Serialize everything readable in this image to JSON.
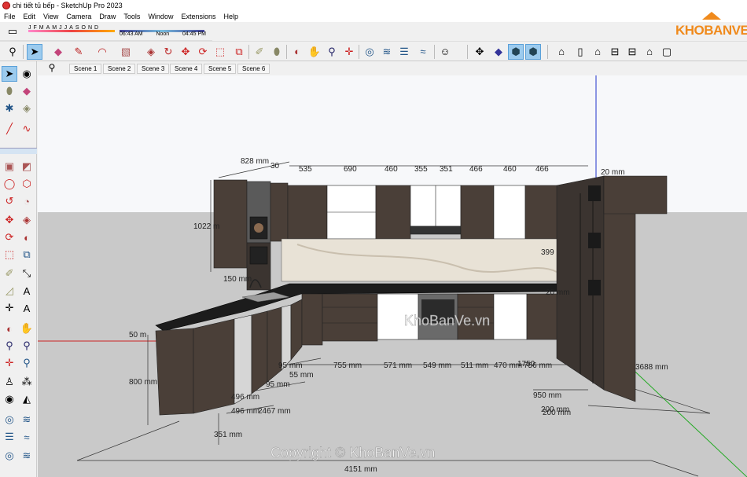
{
  "window": {
    "title": "chi tiết tủ bếp - SketchUp Pro 2023"
  },
  "menu": [
    "File",
    "Edit",
    "View",
    "Camera",
    "Draw",
    "Tools",
    "Window",
    "Extensions",
    "Help"
  ],
  "shadows": {
    "months": [
      "J",
      "F",
      "M",
      "A",
      "M",
      "J",
      "J",
      "A",
      "S",
      "O",
      "N",
      "D"
    ],
    "time_start": "06:43 AM",
    "time_mid": "Noon",
    "time_end": "04:45 PM"
  },
  "logo": {
    "text": "KHOBANVE"
  },
  "scenes": [
    "Scene 1",
    "Scene 2",
    "Scene 3",
    "Scene 4",
    "Scene 5",
    "Scene 6"
  ],
  "toolbar_icons": [
    "search-icon",
    "select-arrow-icon",
    "eraser-icon",
    "pencil-icon",
    "arc-icon",
    "rectangle-icon",
    "push-pull-icon",
    "follow-me-icon",
    "move-icon",
    "rotate-icon",
    "scale-icon",
    "offset-icon",
    "tape-measure-icon",
    "paint-bucket-icon",
    "section-plane-icon",
    "walk-icon",
    "zoom-icon",
    "zoom-extents-icon",
    "sandbox-icon",
    "layers-icon",
    "styles-icon",
    "user-icon",
    "orbit-icon",
    "component-icon",
    "iso-view-icon",
    "top-view-icon",
    "front-view-icon",
    "right-view-icon",
    "back-view-icon",
    "left-view-icon",
    "house-icon",
    "home-outline-icon",
    "page-icon"
  ],
  "dimensions": {
    "top": [
      "828 mm",
      "30",
      "535",
      "690",
      "460",
      "355",
      "351",
      "466",
      "460",
      "466",
      "20 mm"
    ],
    "left_height_upper": "1022 m",
    "left_height_lower": "800 mm",
    "side_small": "50 m",
    "backsplash": "399",
    "right_20": "20 mm",
    "bottom": [
      "755 mm",
      "571 mm",
      "549 mm",
      "511 mm",
      "470 mm",
      "756 mm"
    ],
    "left_bottom": [
      "496 mm",
      "496 mm",
      "2467 mm",
      "351 mm",
      "95 mm",
      "95 mm",
      "55 mm"
    ],
    "right_side": [
      "3688 mm",
      "950 mm",
      "200 mm",
      "200 mm"
    ],
    "total": "4151 mm",
    "misc": "150 mm",
    "misc2": "1750"
  },
  "watermark": {
    "center": "KhoBanVe.vn",
    "bottom": "Copyright © KhoBanVe.vn"
  },
  "colors": {
    "wood_dark": "#4a3f38",
    "countertop": "#1c1c1c",
    "white_panel": "#ffffff",
    "backsplash": "#e8e2d6",
    "accent_orange": "#f08a1c",
    "axis_red": "#cc2222",
    "axis_blue": "#2233cc",
    "axis_green": "#22aa22"
  }
}
